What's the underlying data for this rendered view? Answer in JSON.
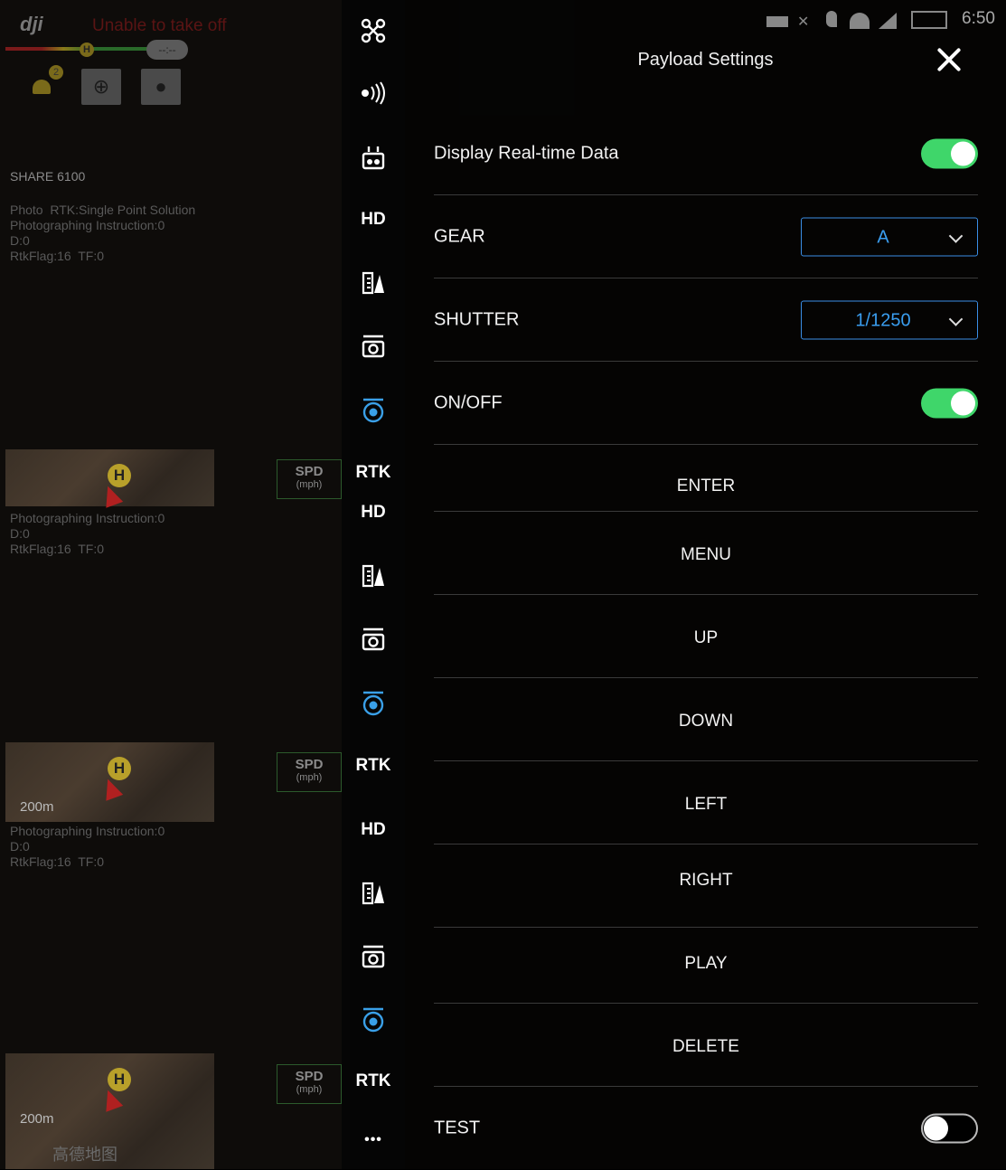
{
  "background": {
    "warning": "Unable to take off",
    "pill": "--:--",
    "notification_count": "2",
    "share_label": "SHARE 6100",
    "info_block_1": "Photo  RTK:Single Point Solution\nPhotographing Instruction:0\nD:0\nRtkFlag:16  TF:0",
    "info_block_2": "Photographing Instruction:0\nD:0\nRtkFlag:16  TF:0",
    "info_block_3": "Photographing Instruction:0\nD:0\nRtkFlag:16  TF:0",
    "spd_label": "SPD",
    "spd_unit": "(mph)",
    "scale": "200m",
    "home": "H",
    "map_watermark": "高德地图"
  },
  "iconbar": {
    "hd": "HD",
    "rtk": "RTK",
    "more": "•••"
  },
  "status_bar": {
    "time": "6:50"
  },
  "panel": {
    "title": "Payload Settings",
    "rows": {
      "display_realtime": {
        "label": "Display Real-time Data",
        "on": true
      },
      "gear": {
        "label": "GEAR",
        "value": "A"
      },
      "shutter": {
        "label": "SHUTTER",
        "value": "1/1250"
      },
      "onoff": {
        "label": "ON/OFF",
        "on": true
      },
      "enter": "ENTER",
      "menu": "MENU",
      "up": "UP",
      "down": "DOWN",
      "left": "LEFT",
      "right": "RIGHT",
      "play": "PLAY",
      "delete": "DELETE",
      "test": {
        "label": "TEST",
        "on": false
      }
    }
  },
  "colors": {
    "toggle_on": "#3fd66a",
    "select_border": "#3a8ee6",
    "icon_blue": "#3aa0e8"
  }
}
